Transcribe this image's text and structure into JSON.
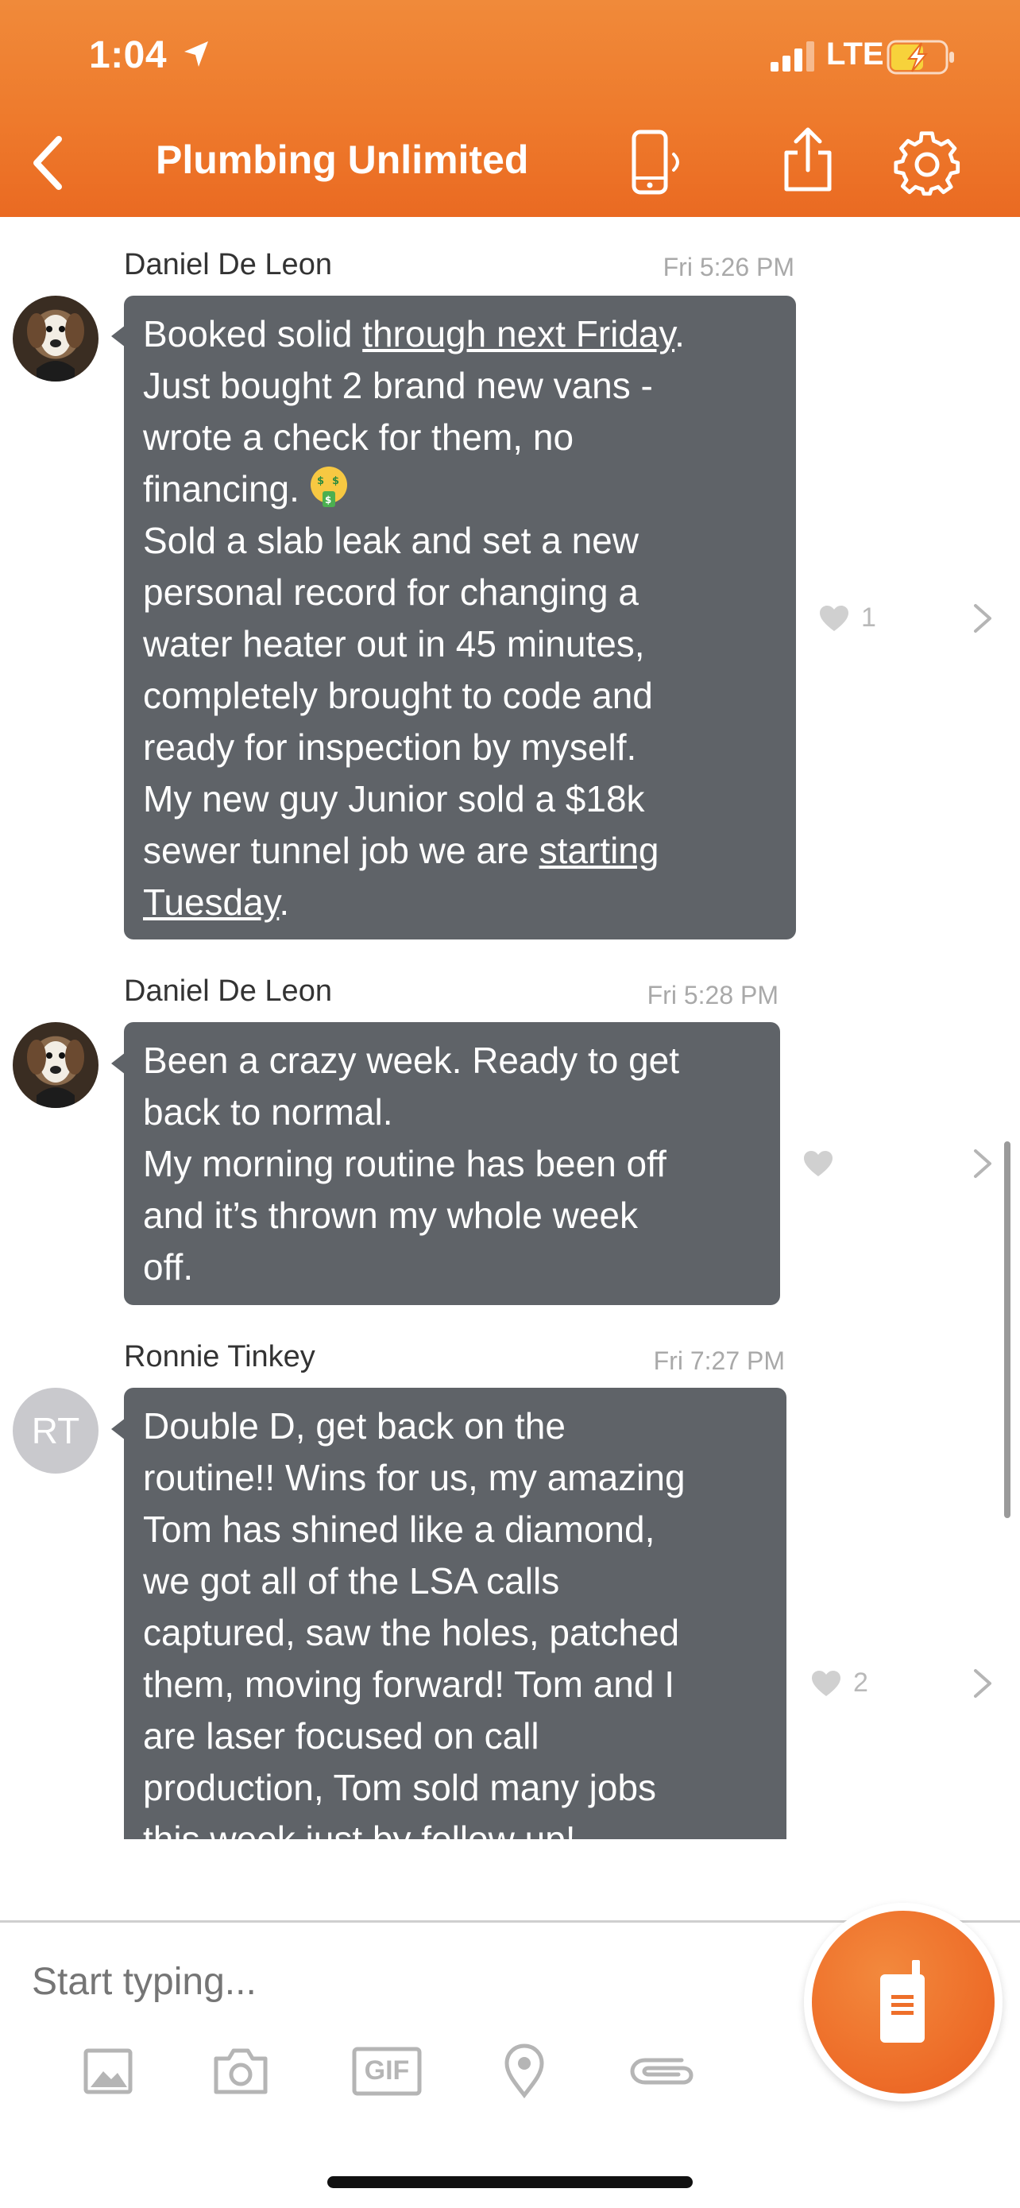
{
  "status_bar": {
    "time": "1:04",
    "network": "LTE"
  },
  "header": {
    "title": "Plumbing Unlimited"
  },
  "messages": [
    {
      "sender": "Daniel De Leon",
      "timestamp": "Fri 5:26 PM",
      "avatar": "dog-photo",
      "lines": [
        {
          "pre": "Booked solid ",
          "link": "through next Friday",
          "post": "."
        },
        {
          "text": "Just bought 2 brand new vans -"
        },
        {
          "text": "wrote a check for them, no"
        },
        {
          "text": "financing."
        },
        {
          "text": "Sold a slab leak and set a new"
        },
        {
          "text": "personal record for changing a"
        },
        {
          "text": "water heater out in 45 minutes,"
        },
        {
          "text": "completely brought to code and"
        },
        {
          "text": "ready for inspection by myself."
        },
        {
          "text": "My new guy Junior sold a $18k"
        },
        {
          "pre": "sewer tunnel job we are ",
          "link": "starting"
        },
        {
          "link": "Tuesday",
          "post": "."
        }
      ],
      "emoji": "money-mouth-face",
      "likes": "1"
    },
    {
      "sender": "Daniel De Leon",
      "timestamp": "Fri 5:28 PM",
      "avatar": "dog-photo",
      "lines": [
        {
          "text": "Been a crazy week. Ready to get"
        },
        {
          "text": "back to normal."
        },
        {
          "text": "My morning routine has been off"
        },
        {
          "text": "and it’s thrown my whole week"
        },
        {
          "text": "off."
        }
      ],
      "likes": ""
    },
    {
      "sender": "Ronnie Tinkey",
      "timestamp": "Fri 7:27 PM",
      "avatar_initials": "RT",
      "lines": [
        {
          "text": "Double D, get back on the"
        },
        {
          "text": "routine!! Wins for us, my amazing"
        },
        {
          "text": "Tom has shined like a diamond,"
        },
        {
          "text": "we got all of the LSA calls"
        },
        {
          "text": "captured, saw the holes, patched"
        },
        {
          "text": "them, moving forward! Tom and I"
        },
        {
          "text": "are laser focused on call"
        },
        {
          "text": "production, Tom sold many jobs"
        },
        {
          "text": "this week just by follow up!"
        }
      ],
      "likes": "2"
    }
  ],
  "composer": {
    "placeholder": "Start typing...",
    "tools": [
      "image-icon",
      "camera-icon",
      "gif-icon",
      "location-pin-icon",
      "paperclip-icon"
    ],
    "gif_label": "GIF"
  },
  "colors": {
    "accent": "#ee7a2c",
    "bubble": "#5f6368"
  }
}
